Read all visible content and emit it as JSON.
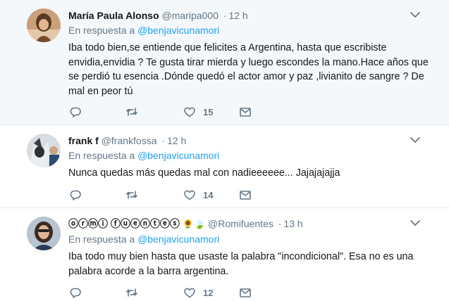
{
  "tweets": [
    {
      "name": "María Paula Alonso",
      "handle": "@maripa000",
      "dot": "·",
      "time": "12 h",
      "reply_prefix": "En respuesta a",
      "reply_to": "@benjavicunamori",
      "text": "Iba todo bien,se entiende que felicites a Argentina,  hasta que escribiste envidia,envidia ? Te gusta tirar mierda y luego escondes la mano.Hace años que se perdió tu esencia .Dónde quedó el actor amor y paz ,livianito de sangre ? De mal en peor tú",
      "likes": "15"
    },
    {
      "name": "frank f",
      "handle": "@frankfossa",
      "dot": "·",
      "time": "12 h",
      "reply_prefix": "En respuesta a",
      "reply_to": "@benjavicunamori",
      "text": "Nunca quedas más quedas mal con nadieeeeee... Jajajajajja",
      "likes": "14"
    },
    {
      "name": "ⓞⓡⓜⓘ ⓕⓤⓔⓝⓣⓔⓢ",
      "name_emoji": "🌻🍃",
      "handle": "@Romifuentes",
      "dot": "·",
      "time": "13 h",
      "reply_prefix": "En respuesta a",
      "reply_to": "@benjavicunamori",
      "text": "Iba todo muy bien hasta que usaste la palabra \"incondicional\". Esa no es una palabra acorde a la barra argentina.",
      "likes": "12"
    }
  ],
  "icons": {
    "reply": "reply-icon",
    "retweet": "retweet-icon",
    "like": "heart-icon",
    "message": "envelope-icon",
    "menu": "chevron-down-icon"
  },
  "colors": {
    "link": "#1da1f2",
    "muted": "#657786",
    "text": "#14171a",
    "highlight_bg": "#f5f8fa"
  }
}
